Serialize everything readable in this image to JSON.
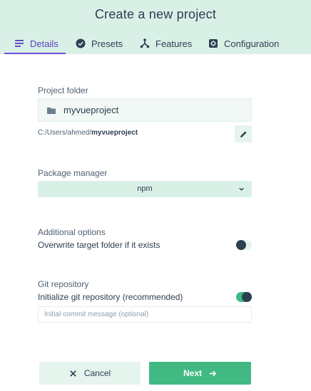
{
  "header": {
    "title": "Create a new project"
  },
  "tabs": [
    {
      "label": "Details",
      "icon": "list-icon",
      "active": true
    },
    {
      "label": "Presets",
      "icon": "check-circle-icon",
      "active": false
    },
    {
      "label": "Features",
      "icon": "branch-icon",
      "active": false
    },
    {
      "label": "Configuration",
      "icon": "settings-icon",
      "active": false
    }
  ],
  "project_folder": {
    "label": "Project folder",
    "value": "myvueproject",
    "path_prefix": "C:/Users/ahmed/",
    "path_name": "myvueproject"
  },
  "package_manager": {
    "label": "Package manager",
    "value": "npm"
  },
  "additional_options": {
    "label": "Additional options",
    "overwrite_label": "Overwrite target folder if it exists",
    "overwrite_enabled": false
  },
  "git": {
    "label": "Git repository",
    "init_label": "Initialize git repository (recommended)",
    "init_enabled": true,
    "commit_placeholder": "Initial commit message (optional)"
  },
  "footer": {
    "cancel_label": "Cancel",
    "next_label": "Next"
  },
  "colors": {
    "accent": "#42b983",
    "header_bg": "#d9f0e7",
    "active_tab": "#6d4fd6",
    "text": "#2c3e50"
  }
}
